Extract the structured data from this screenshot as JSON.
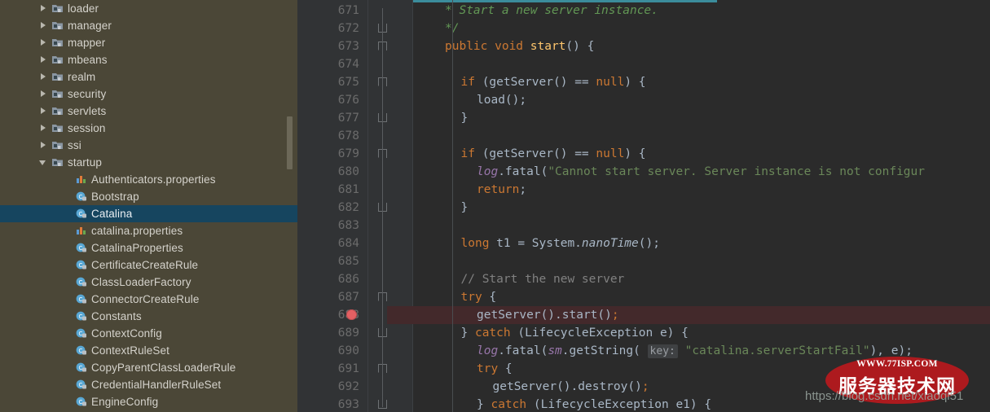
{
  "sidebar": {
    "scrollbar": "vertical-scrollbar",
    "items": [
      {
        "label": "loader",
        "type": "package",
        "twisty": "closed",
        "indent": 0
      },
      {
        "label": "manager",
        "type": "package",
        "twisty": "closed",
        "indent": 0
      },
      {
        "label": "mapper",
        "type": "package",
        "twisty": "closed",
        "indent": 0
      },
      {
        "label": "mbeans",
        "type": "package",
        "twisty": "closed",
        "indent": 0
      },
      {
        "label": "realm",
        "type": "package",
        "twisty": "closed",
        "indent": 0
      },
      {
        "label": "security",
        "type": "package",
        "twisty": "closed",
        "indent": 0
      },
      {
        "label": "servlets",
        "type": "package",
        "twisty": "closed",
        "indent": 0
      },
      {
        "label": "session",
        "type": "package",
        "twisty": "closed",
        "indent": 0
      },
      {
        "label": "ssi",
        "type": "package",
        "twisty": "closed",
        "indent": 0
      },
      {
        "label": "startup",
        "type": "package",
        "twisty": "open",
        "indent": 0
      },
      {
        "label": "Authenticators.properties",
        "type": "properties",
        "twisty": "none",
        "indent": 1
      },
      {
        "label": "Bootstrap",
        "type": "class",
        "twisty": "none",
        "indent": 1
      },
      {
        "label": "Catalina",
        "type": "class",
        "twisty": "none",
        "indent": 1,
        "selected": true
      },
      {
        "label": "catalina.properties",
        "type": "properties",
        "twisty": "none",
        "indent": 1
      },
      {
        "label": "CatalinaProperties",
        "type": "class",
        "twisty": "none",
        "indent": 1
      },
      {
        "label": "CertificateCreateRule",
        "type": "class",
        "twisty": "none",
        "indent": 1
      },
      {
        "label": "ClassLoaderFactory",
        "type": "class",
        "twisty": "none",
        "indent": 1
      },
      {
        "label": "ConnectorCreateRule",
        "type": "class",
        "twisty": "none",
        "indent": 1
      },
      {
        "label": "Constants",
        "type": "class",
        "twisty": "none",
        "indent": 1
      },
      {
        "label": "ContextConfig",
        "type": "class",
        "twisty": "none",
        "indent": 1
      },
      {
        "label": "ContextRuleSet",
        "type": "class",
        "twisty": "none",
        "indent": 1
      },
      {
        "label": "CopyParentClassLoaderRule",
        "type": "class",
        "twisty": "none",
        "indent": 1
      },
      {
        "label": "CredentialHandlerRuleSet",
        "type": "class",
        "twisty": "none",
        "indent": 1
      },
      {
        "label": "EngineConfig",
        "type": "class",
        "twisty": "none",
        "indent": 1
      }
    ]
  },
  "editor": {
    "first_line": 671,
    "breakpoint_line": 688,
    "highlighted_line": 688,
    "lines": [
      {
        "n": 671,
        "indent": 2,
        "tokens": [
          {
            "t": "cmt-doc",
            "v": "* Start a new server instance."
          }
        ]
      },
      {
        "n": 672,
        "indent": 2,
        "tokens": [
          {
            "t": "cmt-doc",
            "v": "*/"
          }
        ],
        "fold": "end"
      },
      {
        "n": 673,
        "indent": 2,
        "tokens": [
          {
            "t": "kw",
            "v": "public "
          },
          {
            "t": "kw",
            "v": "void "
          },
          {
            "t": "mth",
            "v": "start"
          },
          {
            "t": "pln",
            "v": "() {"
          }
        ],
        "fold": "tri"
      },
      {
        "n": 674,
        "indent": 0,
        "tokens": []
      },
      {
        "n": 675,
        "indent": 3,
        "tokens": [
          {
            "t": "kw",
            "v": "if "
          },
          {
            "t": "pln",
            "v": "(getServer() == "
          },
          {
            "t": "kw",
            "v": "null"
          },
          {
            "t": "pln",
            "v": ") {"
          }
        ],
        "fold": "tri"
      },
      {
        "n": 676,
        "indent": 4,
        "tokens": [
          {
            "t": "pln",
            "v": "load();"
          }
        ]
      },
      {
        "n": 677,
        "indent": 3,
        "tokens": [
          {
            "t": "pln",
            "v": "}"
          }
        ],
        "fold": "end"
      },
      {
        "n": 678,
        "indent": 0,
        "tokens": []
      },
      {
        "n": 679,
        "indent": 3,
        "tokens": [
          {
            "t": "kw",
            "v": "if "
          },
          {
            "t": "pln",
            "v": "(getServer() == "
          },
          {
            "t": "kw",
            "v": "null"
          },
          {
            "t": "pln",
            "v": ") {"
          }
        ],
        "fold": "tri"
      },
      {
        "n": 680,
        "indent": 4,
        "tokens": [
          {
            "t": "fld",
            "v": "log"
          },
          {
            "t": "pln",
            "v": ".fatal("
          },
          {
            "t": "str",
            "v": "\"Cannot start server. Server instance is not configur"
          }
        ]
      },
      {
        "n": 681,
        "indent": 4,
        "tokens": [
          {
            "t": "kw",
            "v": "return"
          },
          {
            "t": "pln",
            "v": ";"
          }
        ]
      },
      {
        "n": 682,
        "indent": 3,
        "tokens": [
          {
            "t": "pln",
            "v": "}"
          }
        ],
        "fold": "end"
      },
      {
        "n": 683,
        "indent": 0,
        "tokens": []
      },
      {
        "n": 684,
        "indent": 3,
        "tokens": [
          {
            "t": "kw",
            "v": "long "
          },
          {
            "t": "pln",
            "v": "t1 = System."
          },
          {
            "t": "stat",
            "v": "nanoTime"
          },
          {
            "t": "pln",
            "v": "();"
          }
        ]
      },
      {
        "n": 685,
        "indent": 0,
        "tokens": []
      },
      {
        "n": 686,
        "indent": 3,
        "tokens": [
          {
            "t": "cmt",
            "v": "// Start the new server"
          }
        ]
      },
      {
        "n": 687,
        "indent": 3,
        "tokens": [
          {
            "t": "kw",
            "v": "try "
          },
          {
            "t": "pln",
            "v": "{"
          }
        ],
        "fold": "tri"
      },
      {
        "n": 688,
        "indent": 4,
        "tokens": [
          {
            "t": "pln",
            "v": "getServer().start()"
          },
          {
            "t": "kw",
            "v": ";"
          }
        ]
      },
      {
        "n": 689,
        "indent": 3,
        "tokens": [
          {
            "t": "pln",
            "v": "} "
          },
          {
            "t": "kw",
            "v": "catch "
          },
          {
            "t": "pln",
            "v": "(LifecycleException e) {"
          }
        ],
        "fold": "end"
      },
      {
        "n": 690,
        "indent": 4,
        "tokens": [
          {
            "t": "fld",
            "v": "log"
          },
          {
            "t": "pln",
            "v": ".fatal("
          },
          {
            "t": "fld",
            "v": "sm"
          },
          {
            "t": "pln",
            "v": ".getString( "
          },
          {
            "t": "hint",
            "v": "key:"
          },
          {
            "t": "str",
            "v": " \"catalina.serverStartFail\""
          },
          {
            "t": "pln",
            "v": "), e);"
          }
        ]
      },
      {
        "n": 691,
        "indent": 4,
        "tokens": [
          {
            "t": "kw",
            "v": "try "
          },
          {
            "t": "pln",
            "v": "{"
          }
        ],
        "fold": "tri"
      },
      {
        "n": 692,
        "indent": 5,
        "tokens": [
          {
            "t": "pln",
            "v": "getServer().destroy()"
          },
          {
            "t": "kw",
            "v": ";"
          }
        ]
      },
      {
        "n": 693,
        "indent": 4,
        "tokens": [
          {
            "t": "pln",
            "v": "} "
          },
          {
            "t": "kw",
            "v": "catch "
          },
          {
            "t": "pln",
            "v": "(LifecycleException e1) {"
          }
        ],
        "fold": "end"
      }
    ]
  },
  "watermark": {
    "top_text": "WWW.77ISP.COM",
    "cn_text": "服务器技术网",
    "url": "https://blog.csdn.net/xiaoqi51",
    "oval_color": "#b8191d"
  },
  "colors": {
    "sidebar_bg": "#4b4737",
    "selection": "#16455f",
    "editor_bg": "#2b2b2b",
    "gutter_bg": "#313335",
    "breakpoint": "#e36063",
    "highlight_row": "#43292b",
    "top_rule": "#3b8c9b"
  }
}
